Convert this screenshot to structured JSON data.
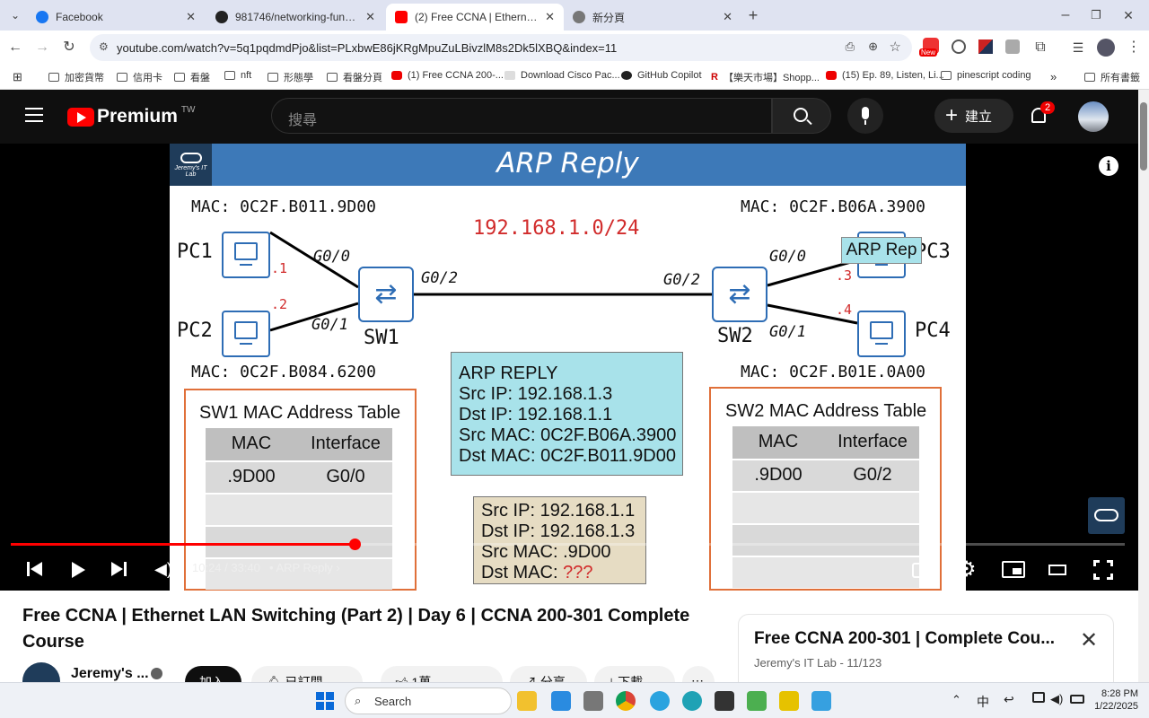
{
  "browser": {
    "tabs": [
      {
        "title": "Facebook",
        "active": false,
        "fav_color": "#1877f2"
      },
      {
        "title": "981746/networking-fundament",
        "active": false,
        "fav_color": "#222222"
      },
      {
        "title": "(2) Free CCNA | Ethernet LAN Sw",
        "active": true,
        "fav_color": "#ff0000"
      },
      {
        "title": "新分頁",
        "active": false,
        "fav_color": "#777777"
      }
    ],
    "url": "youtube.com/watch?v=5q1pqdmdPjo&list=PLxbwE86jKRgMpuZuLBivzlM8s2Dk5lXBQ&index=11",
    "bookmarks": [
      "加密貨幣",
      "信用卡",
      "看盤",
      "nft",
      "形態學",
      "看盤分頁",
      "(1) Free CCNA 200-...",
      "Download Cisco Pac...",
      "GitHub Copilot",
      "【樂天市場】Shopp...",
      "(15) Ep. 89, Listen, Li...",
      "pinescript coding",
      "所有書籤"
    ],
    "new_badge": "New"
  },
  "youtube": {
    "logo_text": "Premium",
    "region": "TW",
    "search_placeholder": "搜尋",
    "create_label": "建立",
    "notif_count": "2"
  },
  "slide": {
    "logo_text": "Jeremy's IT Lab",
    "title": "ARP Reply",
    "network": "192.168.1.0/24",
    "mac_pc1": "MAC: 0C2F.B011.9D00",
    "mac_pc3": "MAC: 0C2F.B06A.3900",
    "mac_pc2": "MAC: 0C2F.B084.6200",
    "mac_pc4": "MAC: 0C2F.B01E.0A00",
    "pc1": "PC1",
    "pc2": "PC2",
    "pc3": "PC3",
    "pc4": "PC4",
    "sw1": "SW1",
    "sw2": "SW2",
    "sw1_g00": "G0/0",
    "sw1_g01": "G0/1",
    "sw1_g02": "G0/2",
    "sw2_g02": "G0/2",
    "sw2_g00": "G0/0",
    "sw2_g01": "G0/1",
    "ip1": ".1",
    "ip2": ".2",
    "ip3": ".3",
    "ip4": ".4",
    "moving_label": "ARP Rep",
    "sw1_table": {
      "title": "SW1 MAC Address Table",
      "headers": [
        "MAC",
        "Interface"
      ],
      "rows": [
        [
          ".9D00",
          "G0/0"
        ]
      ]
    },
    "sw2_table": {
      "title": "SW2 MAC Address Table",
      "headers": [
        "MAC",
        "Interface"
      ],
      "rows": [
        [
          ".9D00",
          "G0/2"
        ]
      ]
    },
    "arp_reply": {
      "lines": [
        "ARP REPLY",
        "Src IP: 192.168.1.3",
        "Dst IP: 192.168.1.1",
        "Src MAC: 0C2F.B06A.3900",
        "Dst MAC: 0C2F.B011.9D00"
      ]
    },
    "arp_request": {
      "l1": "Src IP: 192.168.1.1",
      "l2": "Dst IP: 192.168.1.3",
      "l3": "Src MAC: .9D00",
      "l4a": "Dst MAC: ",
      "l4b": "???"
    }
  },
  "player": {
    "time": "10:24 / 33:40",
    "chapter": "ARP Reply",
    "progress": 0.309
  },
  "video": {
    "title": "Free CCNA | Ethernet LAN Switching (Part 2) | Day 6 | CCNA 200-301 Complete Course",
    "channel": "Jeremy's ...",
    "join": "加入",
    "subscribed": "已訂閱",
    "likes": "1萬",
    "share": "分享",
    "download": "下載"
  },
  "playlist": {
    "title": "Free CCNA 200-301 | Complete Cou...",
    "meta": "Jeremy's IT Lab - 11/123"
  },
  "taskbar": {
    "search": "Search",
    "lang": "中",
    "time": "8:28 PM",
    "date": "1/22/2025"
  }
}
